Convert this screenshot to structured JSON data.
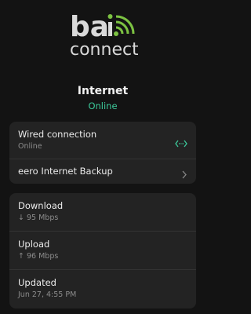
{
  "brand": {
    "logo_text": "bai connect",
    "accent_color": "#7cc242"
  },
  "header": {
    "title": "Internet",
    "status": "Online",
    "status_color": "#3cc99a"
  },
  "connection_card": {
    "wired": {
      "label": "Wired connection",
      "status": "Online",
      "icon": "connection-arrows-icon"
    },
    "backup": {
      "label": "eero Internet Backup",
      "icon": "chevron-right-icon"
    }
  },
  "stats_card": {
    "download": {
      "label": "Download",
      "value": "↓ 95 Mbps"
    },
    "upload": {
      "label": "Upload",
      "value": "↑ 96 Mbps"
    },
    "updated": {
      "label": "Updated",
      "value": "Jun 27, 4:55 PM"
    }
  }
}
